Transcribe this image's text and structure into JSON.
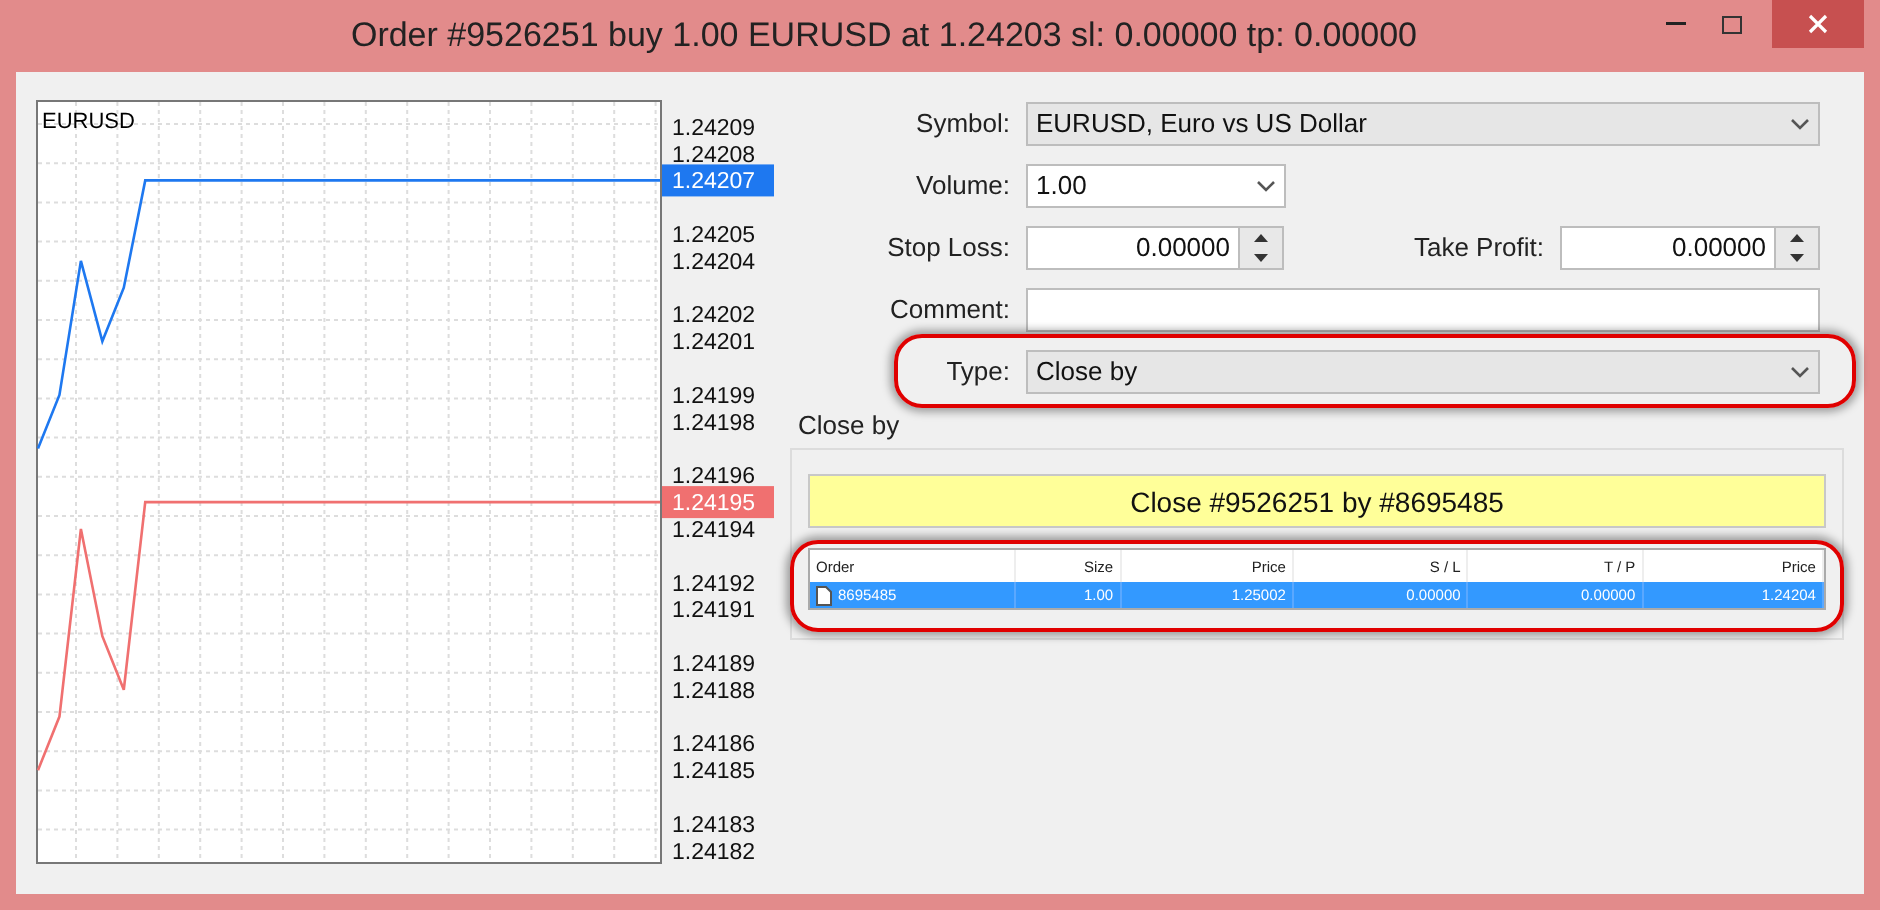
{
  "window": {
    "title": "Order #9526251 buy 1.00 EURUSD at 1.24203 sl: 0.00000 tp: 0.00000"
  },
  "chart": {
    "chart_data": {
      "type": "line",
      "title": "EURUSD",
      "grid": true,
      "ylim": [
        1.241815,
        1.2421
      ],
      "yticks": [
        1.24209,
        1.24208,
        1.24205,
        1.24204,
        1.24202,
        1.24201,
        1.24199,
        1.24198,
        1.24196,
        1.24194,
        1.24192,
        1.24191,
        1.24189,
        1.24188,
        1.24186,
        1.24185,
        1.24183,
        1.24182
      ],
      "series": [
        {
          "color": "#1e78f0",
          "values": [
            1.24197,
            1.24199,
            1.24204,
            1.24201,
            1.24203,
            1.24207,
            1.24207,
            1.24207,
            1.24207,
            1.24207,
            1.24207,
            1.24207,
            1.24207,
            1.24207,
            1.24207,
            1.24207,
            1.24207,
            1.24207,
            1.24207,
            1.24207,
            1.24207,
            1.24207,
            1.24207,
            1.24207,
            1.24207,
            1.24207,
            1.24207,
            1.24207,
            1.24207,
            1.24207
          ]
        },
        {
          "color": "#f07070",
          "values": [
            1.24185,
            1.24187,
            1.24194,
            1.2419,
            1.24188,
            1.24195,
            1.24195,
            1.24195,
            1.24195,
            1.24195,
            1.24195,
            1.24195,
            1.24195,
            1.24195,
            1.24195,
            1.24195,
            1.24195,
            1.24195,
            1.24195,
            1.24195,
            1.24195,
            1.24195,
            1.24195,
            1.24195,
            1.24195,
            1.24195,
            1.24195,
            1.24195,
            1.24195,
            1.24195
          ]
        }
      ]
    },
    "price_markers": [
      {
        "text": "1.24207",
        "color": "#1e78f0"
      },
      {
        "text": "1.24195",
        "color": "#f07070"
      }
    ]
  },
  "form": {
    "symbol": {
      "label": "Symbol:",
      "value": "EURUSD, Euro vs US Dollar"
    },
    "volume": {
      "label": "Volume:",
      "value": "1.00"
    },
    "stop_loss": {
      "label": "Stop Loss:",
      "value": "0.00000"
    },
    "take_profit": {
      "label": "Take Profit:",
      "value": "0.00000"
    },
    "comment": {
      "label": "Comment:"
    },
    "type": {
      "label": "Type:",
      "value": "Close by",
      "highlighted": true
    }
  },
  "close_by": {
    "title": "Close by",
    "button": "Close #9526251 by #8695485",
    "table": {
      "highlighted": true,
      "columns": [
        "Order",
        "Size",
        "Price",
        "S / L",
        "T / P",
        "Price"
      ],
      "rows": [
        {
          "cells": [
            "8695485",
            "1.00",
            "1.25002",
            "0.00000",
            "0.00000",
            "1.24204"
          ],
          "selected": true
        }
      ]
    }
  }
}
